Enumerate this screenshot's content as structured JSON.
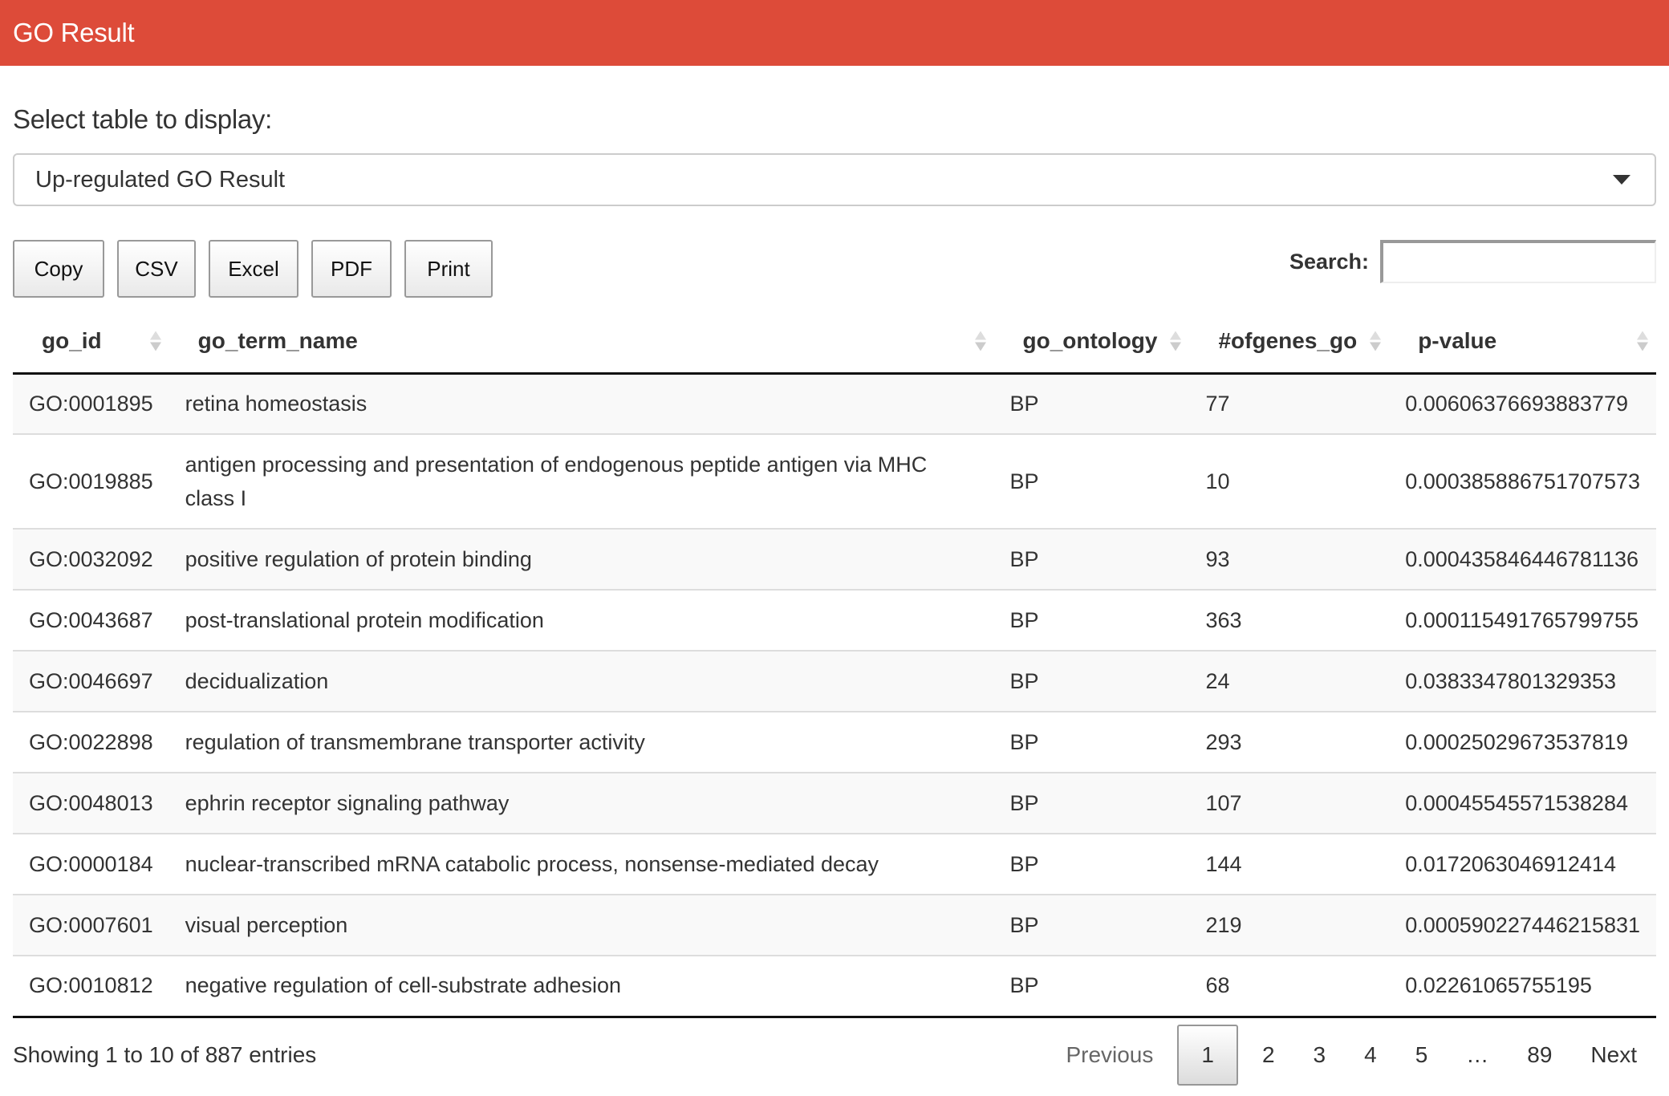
{
  "header": {
    "title": "GO Result",
    "color": "#dd4b39"
  },
  "selector": {
    "label": "Select table to display:",
    "selected": "Up-regulated GO Result",
    "icon": "caret-down-icon"
  },
  "toolbar": {
    "buttons": [
      "Copy",
      "CSV",
      "Excel",
      "PDF",
      "Print"
    ],
    "search_label": "Search:",
    "search_value": "",
    "search_placeholder": ""
  },
  "table": {
    "columns": [
      "go_id",
      "go_term_name",
      "go_ontology",
      "#ofgenes_go",
      "p-value"
    ],
    "rows": [
      [
        "GO:0001895",
        "retina homeostasis",
        "BP",
        "77",
        "0.00606376693883779"
      ],
      [
        "GO:0019885",
        "antigen processing and presentation of endogenous peptide antigen via MHC class I",
        "BP",
        "10",
        "0.000385886751707573"
      ],
      [
        "GO:0032092",
        "positive regulation of protein binding",
        "BP",
        "93",
        "0.000435846446781136"
      ],
      [
        "GO:0043687",
        "post-translational protein modification",
        "BP",
        "363",
        "0.000115491765799755"
      ],
      [
        "GO:0046697",
        "decidualization",
        "BP",
        "24",
        "0.0383347801329353"
      ],
      [
        "GO:0022898",
        "regulation of transmembrane transporter activity",
        "BP",
        "293",
        "0.00025029673537819"
      ],
      [
        "GO:0048013",
        "ephrin receptor signaling pathway",
        "BP",
        "107",
        "0.00045545571538284"
      ],
      [
        "GO:0000184",
        "nuclear-transcribed mRNA catabolic process, nonsense-mediated decay",
        "BP",
        "144",
        "0.0172063046912414"
      ],
      [
        "GO:0007601",
        "visual perception",
        "BP",
        "219",
        "0.000590227446215831"
      ],
      [
        "GO:0010812",
        "negative regulation of cell-substrate adhesion",
        "BP",
        "68",
        "0.02261065755195"
      ]
    ]
  },
  "footer": {
    "info": "Showing 1 to 10 of 887 entries",
    "previous": "Previous",
    "pages": [
      "1",
      "2",
      "3",
      "4",
      "5",
      "…",
      "89"
    ],
    "current_page": "1",
    "next": "Next"
  }
}
